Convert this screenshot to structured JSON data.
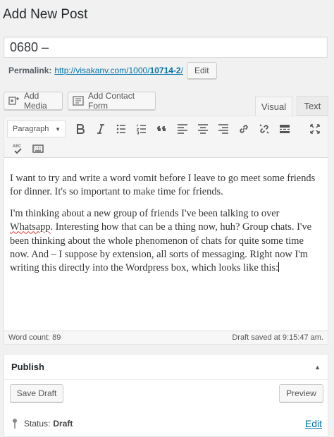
{
  "page": {
    "title": "Add New Post"
  },
  "post": {
    "title_value": "0680 –",
    "permalink_label": "Permalink:",
    "permalink_url_prefix": "http://visakanv.com/1000/",
    "permalink_slug": "10714-2",
    "permalink_url_suffix": "/",
    "edit_label": "Edit"
  },
  "media_buttons": {
    "add_media": "Add Media",
    "add_contact_form": "Add Contact Form"
  },
  "editor_tabs": {
    "visual": "Visual",
    "text": "Text"
  },
  "toolbar": {
    "format_value": "Paragraph",
    "row1_icons": [
      "bold-icon",
      "italic-icon",
      "bulleted-list-icon",
      "numbered-list-icon",
      "blockquote-icon",
      "align-left-icon",
      "align-center-icon",
      "align-right-icon",
      "link-icon",
      "unlink-icon",
      "read-more-icon",
      "fullscreen-icon"
    ],
    "row2_icons": [
      "spellcheck-icon",
      "keyboard-toolbar-toggle-icon"
    ]
  },
  "content": {
    "paragraph1": "I want to try and write a word vomit before I leave to go meet some friends for dinner. It's so important to make time for friends.",
    "paragraph2_before": "I'm thinking about a new group of friends I've been talking to over ",
    "paragraph2_misspelled": "Whatsapp",
    "paragraph2_after": ". Interesting how that can be a thing now, huh? Group chats. I've been thinking about the whole phenomenon of chats for quite some time now. And – I suppose by extension, all sorts of messaging. Right now I'm writing this directly into the Wordpress box, which looks like this:"
  },
  "statusbar": {
    "word_count": "Word count: 89",
    "draft_saved": "Draft saved at 9:15:47 am."
  },
  "publish_box": {
    "title": "Publish",
    "save_draft": "Save Draft",
    "preview": "Preview",
    "status_label": "Status:",
    "status_value": "Draft",
    "status_edit": "Edit"
  },
  "colors": {
    "link": "#0073aa",
    "spellcheck": "#d63638",
    "background": "#f1f1f1"
  }
}
